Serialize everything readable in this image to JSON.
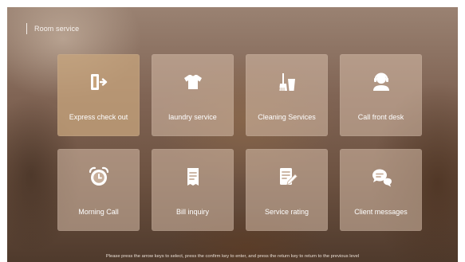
{
  "header": {
    "title": "Room service"
  },
  "tiles": [
    {
      "label": "Express check out",
      "icon": "exit-door-icon",
      "selected": true
    },
    {
      "label": "laundry service",
      "icon": "shirt-icon"
    },
    {
      "label": "Cleaning Services",
      "icon": "broom-bucket-icon"
    },
    {
      "label": "Call front desk",
      "icon": "headset-agent-icon"
    },
    {
      "label": "Morning Call",
      "icon": "alarm-clock-icon"
    },
    {
      "label": "Bill inquiry",
      "icon": "receipt-icon"
    },
    {
      "label": "Service rating",
      "icon": "edit-document-icon"
    },
    {
      "label": "Client messages",
      "icon": "chat-bubbles-icon"
    }
  ],
  "footer": {
    "hint": "Please press the arrow keys to select, press the confirm key to enter, and press the return key to return to the previous level"
  },
  "colors": {
    "icon": "#ffffff",
    "selected_tile": "#c8a57d"
  }
}
